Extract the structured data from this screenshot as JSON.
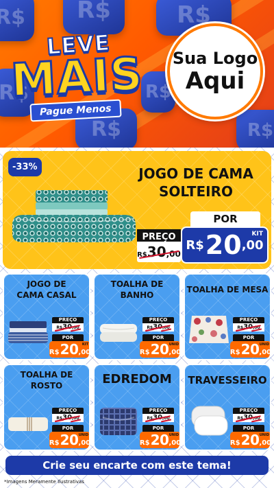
{
  "header": {
    "brand_top": "LEVE",
    "brand_main": "MAIS",
    "brand_sub": "Pague Menos",
    "logo_line1": "Sua Logo",
    "logo_line2": "Aqui",
    "bg_symbol": "R$"
  },
  "featured": {
    "discount": "-33%",
    "title_line1": "JOGO DE CAMA",
    "title_line2": "SOLTEIRO",
    "preco_label": "PREÇO",
    "old_currency": "R$",
    "old_int": "30",
    "old_dec": ",00",
    "por_label": "POR",
    "new_currency": "R$",
    "new_int": "20",
    "new_dec": ",00",
    "new_tag": "KIT"
  },
  "cards": [
    {
      "title": "JOGO DE CAMA CASAL",
      "preco_label": "PREÇO",
      "old_currency": "R$",
      "old_int": "30",
      "old_dec": ",00",
      "por_label": "POR",
      "new_currency": "R$",
      "new_int": "20",
      "new_dec": ",00",
      "tag": "KIT"
    },
    {
      "title": "TOALHA DE BANHO",
      "preco_label": "PREÇO",
      "old_currency": "R$",
      "old_int": "30",
      "old_dec": ",00",
      "por_label": "POR",
      "new_currency": "R$",
      "new_int": "20",
      "new_dec": ",00",
      "tag": "UNID"
    },
    {
      "title": "TOALHA DE MESA",
      "preco_label": "PREÇO",
      "old_currency": "R$",
      "old_int": "30",
      "old_dec": ",00",
      "por_label": "POR",
      "new_currency": "R$",
      "new_int": "20",
      "new_dec": ",00",
      "tag": "UNID"
    },
    {
      "title": "TOALHA DE ROSTO",
      "preco_label": "PREÇO",
      "old_currency": "R$",
      "old_int": "30",
      "old_dec": ",00",
      "por_label": "POR",
      "new_currency": "R$",
      "new_int": "20",
      "new_dec": ",00",
      "tag": "UNID"
    },
    {
      "title": "EDREDOM",
      "preco_label": "PREÇO",
      "old_currency": "R$",
      "old_int": "30",
      "old_dec": ",00",
      "por_label": "POR",
      "new_currency": "R$",
      "new_int": "20",
      "new_dec": ",00",
      "tag": "UNID"
    },
    {
      "title": "TRAVESSEIRO",
      "preco_label": "PREÇO",
      "old_currency": "R$",
      "old_int": "30",
      "old_dec": ",00",
      "por_label": "POR",
      "new_currency": "R$",
      "new_int": "20",
      "new_dec": ",00",
      "tag": "UNID"
    }
  ],
  "footer": {
    "cta": "Crie seu encarte com este tema!",
    "disclaimer": "*Imagens Meramente Ilustrativas"
  },
  "colors": {
    "header_orange": "#ff6a00",
    "featured_yellow": "#ffc319",
    "card_blue": "#4a9ef0",
    "brand_blue": "#1d3aa8",
    "price_orange": "#ff6a00",
    "strike_red": "#d0102a"
  }
}
